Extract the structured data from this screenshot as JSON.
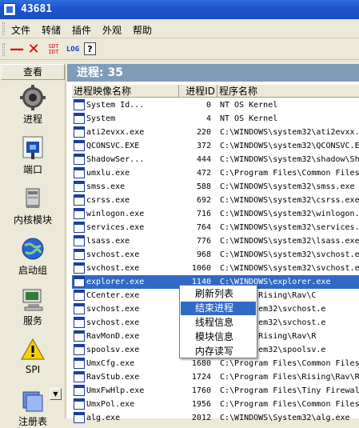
{
  "window": {
    "title": "43681"
  },
  "menu": [
    "文件",
    "转储",
    "插件",
    "外观",
    "帮助"
  ],
  "toolbar": {
    "sdt_top": "SDT",
    "sdt_bottom": "IDT",
    "log": "LOG",
    "help": "?"
  },
  "sidebar": {
    "header": "查看",
    "items": [
      {
        "label": "进程",
        "icon": "gear-icon"
      },
      {
        "label": "端口",
        "icon": "network-port-icon"
      },
      {
        "label": "内核模块",
        "icon": "drive-icon"
      },
      {
        "label": "启动组",
        "icon": "globe-icon"
      },
      {
        "label": "服务",
        "icon": "computer-icon"
      },
      {
        "label": "SPI",
        "icon": "warning-icon"
      },
      {
        "label": "注册表",
        "icon": "registry-icon"
      }
    ]
  },
  "status": {
    "process_count": "进程: 35"
  },
  "table": {
    "headers": [
      "进程映像名称",
      "进程ID",
      "程序名称"
    ],
    "rows": [
      {
        "name": "System Id...",
        "pid": "0",
        "path": "NT OS Kernel"
      },
      {
        "name": "System",
        "pid": "4",
        "path": "NT OS Kernel"
      },
      {
        "name": "ati2evxx.exe",
        "pid": "220",
        "path": "C:\\WINDOWS\\system32\\ati2evxx."
      },
      {
        "name": "QCONSVC.EXE",
        "pid": "372",
        "path": "C:\\WINDOWS\\system32\\QCONSVC.E"
      },
      {
        "name": "ShadowSer...",
        "pid": "444",
        "path": "C:\\WINDOWS\\system32\\shadow\\Sh"
      },
      {
        "name": "umxlu.exe",
        "pid": "472",
        "path": "C:\\Program Files\\Common Files"
      },
      {
        "name": "smss.exe",
        "pid": "588",
        "path": "C:\\WINDOWS\\system32\\smss.exe"
      },
      {
        "name": "csrss.exe",
        "pid": "692",
        "path": "C:\\WINDOWS\\system32\\csrss.exe"
      },
      {
        "name": "winlogon.exe",
        "pid": "716",
        "path": "C:\\WINDOWS\\system32\\winlogon."
      },
      {
        "name": "services.exe",
        "pid": "764",
        "path": "C:\\WINDOWS\\system32\\services."
      },
      {
        "name": "lsass.exe",
        "pid": "776",
        "path": "C:\\WINDOWS\\system32\\lsass.exe"
      },
      {
        "name": "svchost.exe",
        "pid": "968",
        "path": "C:\\WINDOWS\\system32\\svchost.e"
      },
      {
        "name": "svchost.exe",
        "pid": "1060",
        "path": "C:\\WINDOWS\\system32\\svchost.e"
      },
      {
        "name": "explorer.exe",
        "pid": "1140",
        "path": "C:\\WINDOWS\\explorer.exe",
        "selected": true
      },
      {
        "name": "CCenter.exe",
        "pid": "",
        "path": "m Files\\Rising\\Rav\\C"
      },
      {
        "name": "svchost.exe",
        "pid": "",
        "path": "OWS\\system32\\svchost.e"
      },
      {
        "name": "svchost.exe",
        "pid": "",
        "path": "OWS\\system32\\svchost.e"
      },
      {
        "name": "RavMonD.exe",
        "pid": "",
        "path": "m Files\\Rising\\Rav\\R"
      },
      {
        "name": "spoolsv.exe",
        "pid": "",
        "path": "OWS\\system32\\spoolsv.e"
      },
      {
        "name": "UmxCfg.exe",
        "pid": "1680",
        "path": "C:\\Program Files\\Common Files"
      },
      {
        "name": "RavStub.exe",
        "pid": "1724",
        "path": "C:\\Program Files\\Rising\\Rav\\R"
      },
      {
        "name": "UmxFwHlp.exe",
        "pid": "1760",
        "path": "C:\\Program Files\\Tiny Firewal"
      },
      {
        "name": "UmxPol.exe",
        "pid": "1956",
        "path": "C:\\Program Files\\Common Files"
      },
      {
        "name": "alg.exe",
        "pid": "2012",
        "path": "C:\\WINDOWS\\System32\\alg.exe"
      }
    ]
  },
  "context_menu": {
    "items": [
      "刷新列表",
      "结束进程",
      "线程信息",
      "模块信息",
      "内存读写"
    ],
    "highlighted_index": 1
  }
}
